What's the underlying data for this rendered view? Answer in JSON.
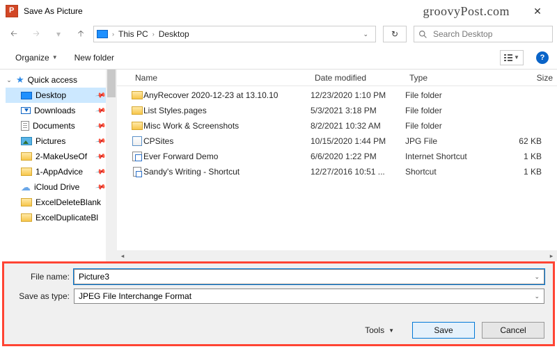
{
  "window": {
    "title": "Save As Picture"
  },
  "watermark": "groovyPost.com",
  "breadcrumb": {
    "parts": [
      "This PC",
      "Desktop"
    ]
  },
  "search": {
    "placeholder": "Search Desktop"
  },
  "toolbar": {
    "organize": "Organize",
    "new_folder": "New folder"
  },
  "columns": {
    "name": "Name",
    "date": "Date modified",
    "type": "Type",
    "size": "Size"
  },
  "tree": {
    "quick_access": "Quick access",
    "items": [
      {
        "label": "Desktop",
        "pinned": true,
        "icon": "monitor",
        "selected": true
      },
      {
        "label": "Downloads",
        "pinned": true,
        "icon": "download"
      },
      {
        "label": "Documents",
        "pinned": true,
        "icon": "document"
      },
      {
        "label": "Pictures",
        "pinned": true,
        "icon": "picture"
      },
      {
        "label": "2-MakeUseOf",
        "pinned": true,
        "icon": "folder"
      },
      {
        "label": "1-AppAdvice",
        "pinned": true,
        "icon": "folder"
      },
      {
        "label": "iCloud Drive",
        "pinned": true,
        "icon": "cloud"
      },
      {
        "label": "ExcelDeleteBlank",
        "pinned": false,
        "icon": "folder"
      },
      {
        "label": "ExcelDuplicateBl",
        "pinned": false,
        "icon": "folder"
      }
    ]
  },
  "files": [
    {
      "name": "AnyRecover 2020-12-23 at 13.10.10",
      "date": "12/23/2020 1:10 PM",
      "type": "File folder",
      "size": "",
      "icon": "folder"
    },
    {
      "name": "List Styles.pages",
      "date": "5/3/2021 3:18 PM",
      "type": "File folder",
      "size": "",
      "icon": "folder"
    },
    {
      "name": "Misc Work & Screenshots",
      "date": "8/2/2021 10:32 AM",
      "type": "File folder",
      "size": "",
      "icon": "folder"
    },
    {
      "name": "CPSites",
      "date": "10/15/2020 1:44 PM",
      "type": "JPG File",
      "size": "62 KB",
      "icon": "jpg"
    },
    {
      "name": "Ever Forward Demo",
      "date": "6/6/2020 1:22 PM",
      "type": "Internet Shortcut",
      "size": "1 KB",
      "icon": "url"
    },
    {
      "name": "Sandy's Writing - Shortcut",
      "date": "12/27/2016 10:51 ...",
      "type": "Shortcut",
      "size": "1 KB",
      "icon": "lnk"
    }
  ],
  "form": {
    "file_name_label": "File name:",
    "file_name_value": "Picture3",
    "save_type_label": "Save as type:",
    "save_type_value": "JPEG File Interchange Format",
    "tools": "Tools",
    "save": "Save",
    "cancel": "Cancel"
  }
}
